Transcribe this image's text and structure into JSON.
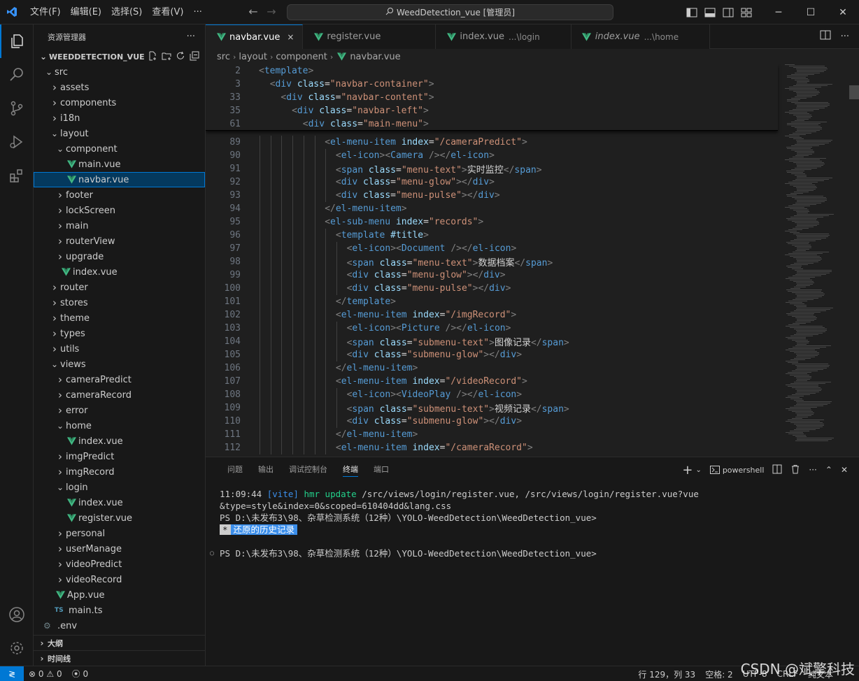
{
  "titlebar": {
    "menus": [
      "文件(F)",
      "编辑(E)",
      "选择(S)",
      "查看(V)",
      "···"
    ],
    "search_text": "WeedDetection_vue [管理员]",
    "accent": "#0078d4"
  },
  "sidebar": {
    "title": "资源管理器",
    "more": "···",
    "project": "WEEDDETECTION_VUE",
    "tree": [
      {
        "label": "src",
        "depth": 0,
        "kind": "folder-open"
      },
      {
        "label": "assets",
        "depth": 1,
        "kind": "folder"
      },
      {
        "label": "components",
        "depth": 1,
        "kind": "folder"
      },
      {
        "label": "i18n",
        "depth": 1,
        "kind": "folder"
      },
      {
        "label": "layout",
        "depth": 1,
        "kind": "folder-open"
      },
      {
        "label": "component",
        "depth": 2,
        "kind": "folder-open"
      },
      {
        "label": "main.vue",
        "depth": 3,
        "kind": "vue"
      },
      {
        "label": "navbar.vue",
        "depth": 3,
        "kind": "vue",
        "selected": true
      },
      {
        "label": "footer",
        "depth": 2,
        "kind": "folder"
      },
      {
        "label": "lockScreen",
        "depth": 2,
        "kind": "folder"
      },
      {
        "label": "main",
        "depth": 2,
        "kind": "folder"
      },
      {
        "label": "routerView",
        "depth": 2,
        "kind": "folder"
      },
      {
        "label": "upgrade",
        "depth": 2,
        "kind": "folder"
      },
      {
        "label": "index.vue",
        "depth": 2,
        "kind": "vue"
      },
      {
        "label": "router",
        "depth": 1,
        "kind": "folder"
      },
      {
        "label": "stores",
        "depth": 1,
        "kind": "folder"
      },
      {
        "label": "theme",
        "depth": 1,
        "kind": "folder"
      },
      {
        "label": "types",
        "depth": 1,
        "kind": "folder"
      },
      {
        "label": "utils",
        "depth": 1,
        "kind": "folder"
      },
      {
        "label": "views",
        "depth": 1,
        "kind": "folder-open"
      },
      {
        "label": "cameraPredict",
        "depth": 2,
        "kind": "folder"
      },
      {
        "label": "cameraRecord",
        "depth": 2,
        "kind": "folder"
      },
      {
        "label": "error",
        "depth": 2,
        "kind": "folder"
      },
      {
        "label": "home",
        "depth": 2,
        "kind": "folder-open"
      },
      {
        "label": "index.vue",
        "depth": 3,
        "kind": "vue"
      },
      {
        "label": "imgPredict",
        "depth": 2,
        "kind": "folder"
      },
      {
        "label": "imgRecord",
        "depth": 2,
        "kind": "folder"
      },
      {
        "label": "login",
        "depth": 2,
        "kind": "folder-open"
      },
      {
        "label": "index.vue",
        "depth": 3,
        "kind": "vue"
      },
      {
        "label": "register.vue",
        "depth": 3,
        "kind": "vue"
      },
      {
        "label": "personal",
        "depth": 2,
        "kind": "folder"
      },
      {
        "label": "userManage",
        "depth": 2,
        "kind": "folder"
      },
      {
        "label": "videoPredict",
        "depth": 2,
        "kind": "folder"
      },
      {
        "label": "videoRecord",
        "depth": 2,
        "kind": "folder"
      },
      {
        "label": "App.vue",
        "depth": 1,
        "kind": "vue"
      },
      {
        "label": "main.ts",
        "depth": 1,
        "kind": "ts",
        "prefix": "TS"
      },
      {
        "label": ".env",
        "depth": 0,
        "kind": "env"
      }
    ],
    "outline": "大纲",
    "timeline": "时间线"
  },
  "tabs": [
    {
      "label": "navbar.vue",
      "active": true,
      "close": "×"
    },
    {
      "label": "register.vue"
    },
    {
      "label": "index.vue",
      "desc": "...\\login"
    },
    {
      "label": "index.vue",
      "desc": "...\\home",
      "italic": true
    }
  ],
  "breadcrumb": [
    "src",
    "layout",
    "component",
    "navbar.vue"
  ],
  "sticky_lines": [
    {
      "n": "2",
      "indent": 0,
      "code": [
        [
          "t-punc",
          "<"
        ],
        [
          "t-tag",
          "template"
        ],
        [
          "t-punc",
          ">"
        ]
      ]
    },
    {
      "n": "3",
      "indent": 1,
      "code": [
        [
          "t-punc",
          "<"
        ],
        [
          "t-tag",
          "div"
        ],
        [
          "t-text",
          " "
        ],
        [
          "t-attr",
          "class"
        ],
        [
          "t-text",
          "="
        ],
        [
          "t-str",
          "\"navbar-container\""
        ],
        [
          "t-punc",
          ">"
        ]
      ]
    },
    {
      "n": "33",
      "indent": 2,
      "code": [
        [
          "t-punc",
          "<"
        ],
        [
          "t-tag",
          "div"
        ],
        [
          "t-text",
          " "
        ],
        [
          "t-attr",
          "class"
        ],
        [
          "t-text",
          "="
        ],
        [
          "t-str",
          "\"navbar-content\""
        ],
        [
          "t-punc",
          ">"
        ]
      ]
    },
    {
      "n": "35",
      "indent": 3,
      "code": [
        [
          "t-punc",
          "<"
        ],
        [
          "t-tag",
          "div"
        ],
        [
          "t-text",
          " "
        ],
        [
          "t-attr",
          "class"
        ],
        [
          "t-text",
          "="
        ],
        [
          "t-str",
          "\"navbar-left\""
        ],
        [
          "t-punc",
          ">"
        ]
      ]
    },
    {
      "n": "61",
      "indent": 4,
      "code": [
        [
          "t-punc",
          "<"
        ],
        [
          "t-tag",
          "div"
        ],
        [
          "t-text",
          " "
        ],
        [
          "t-attr",
          "class"
        ],
        [
          "t-text",
          "="
        ],
        [
          "t-str",
          "\"main-menu\""
        ],
        [
          "t-punc",
          ">"
        ]
      ]
    }
  ],
  "code_lines": [
    {
      "n": "89",
      "indent": 6,
      "code": [
        [
          "t-punc",
          "<"
        ],
        [
          "t-tag",
          "el-menu-item"
        ],
        [
          "t-text",
          " "
        ],
        [
          "t-attr",
          "index"
        ],
        [
          "t-text",
          "="
        ],
        [
          "t-str",
          "\"/cameraPredict\""
        ],
        [
          "t-punc",
          ">"
        ]
      ]
    },
    {
      "n": "90",
      "indent": 7,
      "code": [
        [
          "t-punc",
          "<"
        ],
        [
          "t-tag",
          "el-icon"
        ],
        [
          "t-punc",
          "><"
        ],
        [
          "t-tag",
          "Camera"
        ],
        [
          "t-text",
          " "
        ],
        [
          "t-punc",
          "/></"
        ],
        [
          "t-tag",
          "el-icon"
        ],
        [
          "t-punc",
          ">"
        ]
      ]
    },
    {
      "n": "91",
      "indent": 7,
      "code": [
        [
          "t-punc",
          "<"
        ],
        [
          "t-tag",
          "span"
        ],
        [
          "t-text",
          " "
        ],
        [
          "t-attr",
          "class"
        ],
        [
          "t-text",
          "="
        ],
        [
          "t-str",
          "\"menu-text\""
        ],
        [
          "t-punc",
          ">"
        ],
        [
          "t-text",
          "实时监控"
        ],
        [
          "t-punc",
          "</"
        ],
        [
          "t-tag",
          "span"
        ],
        [
          "t-punc",
          ">"
        ]
      ]
    },
    {
      "n": "92",
      "indent": 7,
      "code": [
        [
          "t-punc",
          "<"
        ],
        [
          "t-tag",
          "div"
        ],
        [
          "t-text",
          " "
        ],
        [
          "t-attr",
          "class"
        ],
        [
          "t-text",
          "="
        ],
        [
          "t-str",
          "\"menu-glow\""
        ],
        [
          "t-punc",
          "></"
        ],
        [
          "t-tag",
          "div"
        ],
        [
          "t-punc",
          ">"
        ]
      ]
    },
    {
      "n": "93",
      "indent": 7,
      "code": [
        [
          "t-punc",
          "<"
        ],
        [
          "t-tag",
          "div"
        ],
        [
          "t-text",
          " "
        ],
        [
          "t-attr",
          "class"
        ],
        [
          "t-text",
          "="
        ],
        [
          "t-str",
          "\"menu-pulse\""
        ],
        [
          "t-punc",
          "></"
        ],
        [
          "t-tag",
          "div"
        ],
        [
          "t-punc",
          ">"
        ]
      ]
    },
    {
      "n": "94",
      "indent": 6,
      "code": [
        [
          "t-punc",
          "</"
        ],
        [
          "t-tag",
          "el-menu-item"
        ],
        [
          "t-punc",
          ">"
        ]
      ]
    },
    {
      "n": "95",
      "indent": 6,
      "code": [
        [
          "t-punc",
          "<"
        ],
        [
          "t-tag",
          "el-sub-menu"
        ],
        [
          "t-text",
          " "
        ],
        [
          "t-attr",
          "index"
        ],
        [
          "t-text",
          "="
        ],
        [
          "t-str",
          "\"records\""
        ],
        [
          "t-punc",
          ">"
        ]
      ]
    },
    {
      "n": "96",
      "indent": 7,
      "code": [
        [
          "t-punc",
          "<"
        ],
        [
          "t-tag",
          "template"
        ],
        [
          "t-text",
          " "
        ],
        [
          "t-attr",
          "#title"
        ],
        [
          "t-punc",
          ">"
        ]
      ]
    },
    {
      "n": "97",
      "indent": 8,
      "code": [
        [
          "t-punc",
          "<"
        ],
        [
          "t-tag",
          "el-icon"
        ],
        [
          "t-punc",
          "><"
        ],
        [
          "t-tag",
          "Document"
        ],
        [
          "t-text",
          " "
        ],
        [
          "t-punc",
          "/></"
        ],
        [
          "t-tag",
          "el-icon"
        ],
        [
          "t-punc",
          ">"
        ]
      ]
    },
    {
      "n": "98",
      "indent": 8,
      "code": [
        [
          "t-punc",
          "<"
        ],
        [
          "t-tag",
          "span"
        ],
        [
          "t-text",
          " "
        ],
        [
          "t-attr",
          "class"
        ],
        [
          "t-text",
          "="
        ],
        [
          "t-str",
          "\"menu-text\""
        ],
        [
          "t-punc",
          ">"
        ],
        [
          "t-text",
          "数据档案"
        ],
        [
          "t-punc",
          "</"
        ],
        [
          "t-tag",
          "span"
        ],
        [
          "t-punc",
          ">"
        ]
      ]
    },
    {
      "n": "99",
      "indent": 8,
      "code": [
        [
          "t-punc",
          "<"
        ],
        [
          "t-tag",
          "div"
        ],
        [
          "t-text",
          " "
        ],
        [
          "t-attr",
          "class"
        ],
        [
          "t-text",
          "="
        ],
        [
          "t-str",
          "\"menu-glow\""
        ],
        [
          "t-punc",
          "></"
        ],
        [
          "t-tag",
          "div"
        ],
        [
          "t-punc",
          ">"
        ]
      ]
    },
    {
      "n": "100",
      "indent": 8,
      "code": [
        [
          "t-punc",
          "<"
        ],
        [
          "t-tag",
          "div"
        ],
        [
          "t-text",
          " "
        ],
        [
          "t-attr",
          "class"
        ],
        [
          "t-text",
          "="
        ],
        [
          "t-str",
          "\"menu-pulse\""
        ],
        [
          "t-punc",
          "></"
        ],
        [
          "t-tag",
          "div"
        ],
        [
          "t-punc",
          ">"
        ]
      ]
    },
    {
      "n": "101",
      "indent": 7,
      "code": [
        [
          "t-punc",
          "</"
        ],
        [
          "t-tag",
          "template"
        ],
        [
          "t-punc",
          ">"
        ]
      ]
    },
    {
      "n": "102",
      "indent": 7,
      "code": [
        [
          "t-punc",
          "<"
        ],
        [
          "t-tag",
          "el-menu-item"
        ],
        [
          "t-text",
          " "
        ],
        [
          "t-attr",
          "index"
        ],
        [
          "t-text",
          "="
        ],
        [
          "t-str",
          "\"/imgRecord\""
        ],
        [
          "t-punc",
          ">"
        ]
      ]
    },
    {
      "n": "103",
      "indent": 8,
      "code": [
        [
          "t-punc",
          "<"
        ],
        [
          "t-tag",
          "el-icon"
        ],
        [
          "t-punc",
          "><"
        ],
        [
          "t-tag",
          "Picture"
        ],
        [
          "t-text",
          " "
        ],
        [
          "t-punc",
          "/></"
        ],
        [
          "t-tag",
          "el-icon"
        ],
        [
          "t-punc",
          ">"
        ]
      ]
    },
    {
      "n": "104",
      "indent": 8,
      "code": [
        [
          "t-punc",
          "<"
        ],
        [
          "t-tag",
          "span"
        ],
        [
          "t-text",
          " "
        ],
        [
          "t-attr",
          "class"
        ],
        [
          "t-text",
          "="
        ],
        [
          "t-str",
          "\"submenu-text\""
        ],
        [
          "t-punc",
          ">"
        ],
        [
          "t-text",
          "图像记录"
        ],
        [
          "t-punc",
          "</"
        ],
        [
          "t-tag",
          "span"
        ],
        [
          "t-punc",
          ">"
        ]
      ]
    },
    {
      "n": "105",
      "indent": 8,
      "code": [
        [
          "t-punc",
          "<"
        ],
        [
          "t-tag",
          "div"
        ],
        [
          "t-text",
          " "
        ],
        [
          "t-attr",
          "class"
        ],
        [
          "t-text",
          "="
        ],
        [
          "t-str",
          "\"submenu-glow\""
        ],
        [
          "t-punc",
          "></"
        ],
        [
          "t-tag",
          "div"
        ],
        [
          "t-punc",
          ">"
        ]
      ]
    },
    {
      "n": "106",
      "indent": 7,
      "code": [
        [
          "t-punc",
          "</"
        ],
        [
          "t-tag",
          "el-menu-item"
        ],
        [
          "t-punc",
          ">"
        ]
      ]
    },
    {
      "n": "107",
      "indent": 7,
      "code": [
        [
          "t-punc",
          "<"
        ],
        [
          "t-tag",
          "el-menu-item"
        ],
        [
          "t-text",
          " "
        ],
        [
          "t-attr",
          "index"
        ],
        [
          "t-text",
          "="
        ],
        [
          "t-str",
          "\"/videoRecord\""
        ],
        [
          "t-punc",
          ">"
        ]
      ]
    },
    {
      "n": "108",
      "indent": 8,
      "code": [
        [
          "t-punc",
          "<"
        ],
        [
          "t-tag",
          "el-icon"
        ],
        [
          "t-punc",
          "><"
        ],
        [
          "t-tag",
          "VideoPlay"
        ],
        [
          "t-text",
          " "
        ],
        [
          "t-punc",
          "/></"
        ],
        [
          "t-tag",
          "el-icon"
        ],
        [
          "t-punc",
          ">"
        ]
      ]
    },
    {
      "n": "109",
      "indent": 8,
      "code": [
        [
          "t-punc",
          "<"
        ],
        [
          "t-tag",
          "span"
        ],
        [
          "t-text",
          " "
        ],
        [
          "t-attr",
          "class"
        ],
        [
          "t-text",
          "="
        ],
        [
          "t-str",
          "\"submenu-text\""
        ],
        [
          "t-punc",
          ">"
        ],
        [
          "t-text",
          "视频记录"
        ],
        [
          "t-punc",
          "</"
        ],
        [
          "t-tag",
          "span"
        ],
        [
          "t-punc",
          ">"
        ]
      ]
    },
    {
      "n": "110",
      "indent": 8,
      "code": [
        [
          "t-punc",
          "<"
        ],
        [
          "t-tag",
          "div"
        ],
        [
          "t-text",
          " "
        ],
        [
          "t-attr",
          "class"
        ],
        [
          "t-text",
          "="
        ],
        [
          "t-str",
          "\"submenu-glow\""
        ],
        [
          "t-punc",
          "></"
        ],
        [
          "t-tag",
          "div"
        ],
        [
          "t-punc",
          ">"
        ]
      ]
    },
    {
      "n": "111",
      "indent": 7,
      "code": [
        [
          "t-punc",
          "</"
        ],
        [
          "t-tag",
          "el-menu-item"
        ],
        [
          "t-punc",
          ">"
        ]
      ]
    },
    {
      "n": "112",
      "indent": 7,
      "code": [
        [
          "t-punc",
          "<"
        ],
        [
          "t-tag",
          "el-menu-item"
        ],
        [
          "t-text",
          " "
        ],
        [
          "t-attr",
          "index"
        ],
        [
          "t-text",
          "="
        ],
        [
          "t-str",
          "\"/cameraRecord\""
        ],
        [
          "t-punc",
          ">"
        ]
      ]
    }
  ],
  "panel": {
    "tabs": [
      "问题",
      "输出",
      "调试控制台",
      "终端",
      "端口"
    ],
    "active_tab": "终端",
    "shell": "powershell",
    "terminal": {
      "time": "11:09:44",
      "vite_tag": "[vite]",
      "hmr": "hmr update",
      "hmr_path": " /src/views/login/register.vue, /src/views/login/register.vue?vue",
      "hmr_cont": "&type=style&index=0&scoped=610404dd&lang.css",
      "prompt1": "PS D:\\未发布3\\98、杂草检测系统（12种）\\YOLO-WeedDetection\\WeedDetection_vue>",
      "history_mark": "*",
      "history_text": "还原的历史记录",
      "prompt2": "PS D:\\未发布3\\98、杂草检测系统（12种）\\YOLO-WeedDetection\\WeedDetection_vue>"
    }
  },
  "statusbar": {
    "errors": "0",
    "warnings": "0",
    "ports": "0",
    "position": "行 129，列 33",
    "spaces": "空格: 2",
    "encoding": "UTF-8",
    "eol": "CRLF",
    "lang": "纯文本"
  },
  "watermark": "CSDN @斌擎科技"
}
